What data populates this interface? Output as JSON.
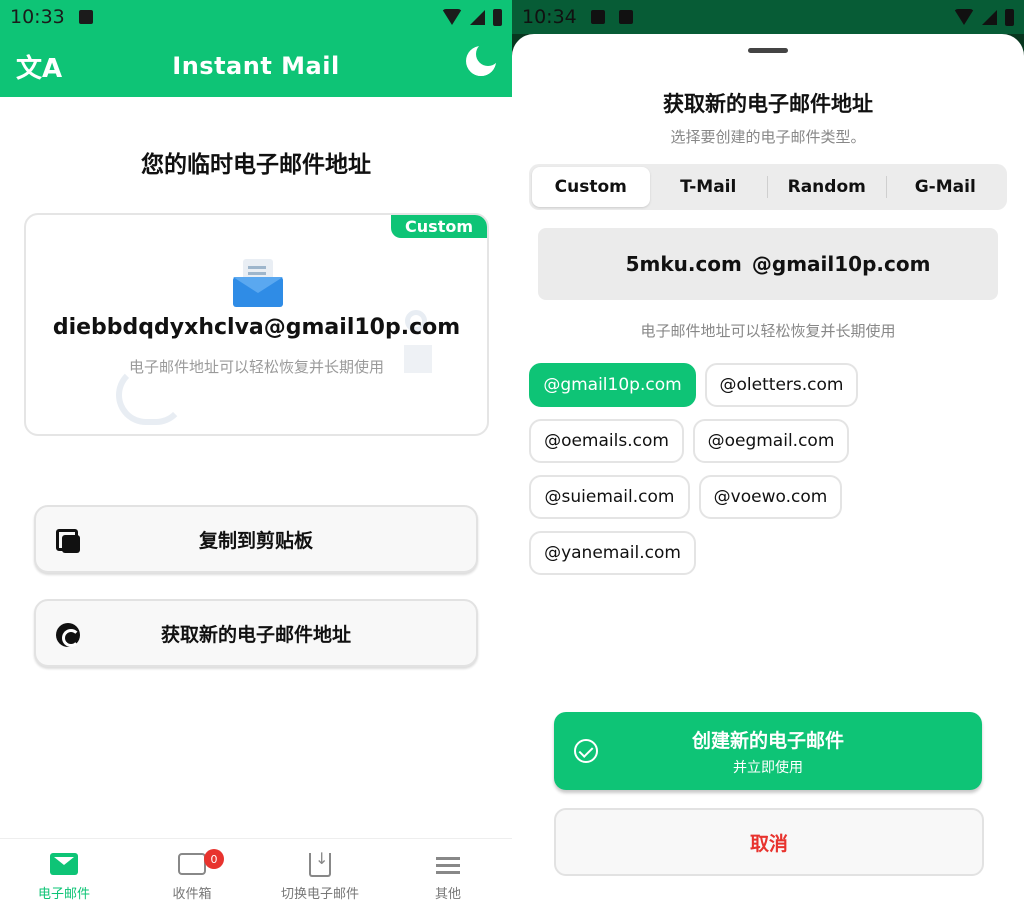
{
  "colors": {
    "accent": "#0EC476",
    "danger": "#E8332E",
    "badge": "#E8332E"
  },
  "left": {
    "status": {
      "time": "10:33"
    },
    "appbar": {
      "title": "Instant Mail",
      "left_icon": "translate-icon",
      "right_icon": "moon-icon"
    },
    "heading": "您的临时电子邮件地址",
    "card": {
      "badge": "Custom",
      "address": "diebbdqdyxhclva@gmail10p.com",
      "note": "电子邮件地址可以轻松恢复并长期使用",
      "icon": "mail-icon"
    },
    "actions": {
      "copy": "复制到剪贴板",
      "new": "获取新的电子邮件地址"
    },
    "bottom_nav": {
      "items": [
        {
          "label": "电子邮件",
          "icon": "mail-icon",
          "active": true
        },
        {
          "label": "收件箱",
          "icon": "inbox-icon",
          "badge": "0"
        },
        {
          "label": "切换电子邮件",
          "icon": "switch-icon"
        },
        {
          "label": "其他",
          "icon": "menu-icon"
        }
      ]
    }
  },
  "right": {
    "status": {
      "time": "10:34"
    },
    "sheet": {
      "title": "获取新的电子邮件地址",
      "subtitle": "选择要创建的电子邮件类型。",
      "tabs": [
        "Custom",
        "T-Mail",
        "Random",
        "G-Mail"
      ],
      "selected_tab": "Custom",
      "preview_user": "5mku.com",
      "preview_domain": "@gmail10p.com",
      "hint": "电子邮件地址可以轻松恢复并长期使用",
      "domains": [
        "@gmail10p.com",
        "@oletters.com",
        "@oemails.com",
        "@oegmail.com",
        "@suiemail.com",
        "@voewo.com",
        "@yanemail.com"
      ],
      "selected_domain": "@gmail10p.com",
      "create_line1": "创建新的电子邮件",
      "create_line2": "并立即使用",
      "cancel": "取消"
    }
  }
}
